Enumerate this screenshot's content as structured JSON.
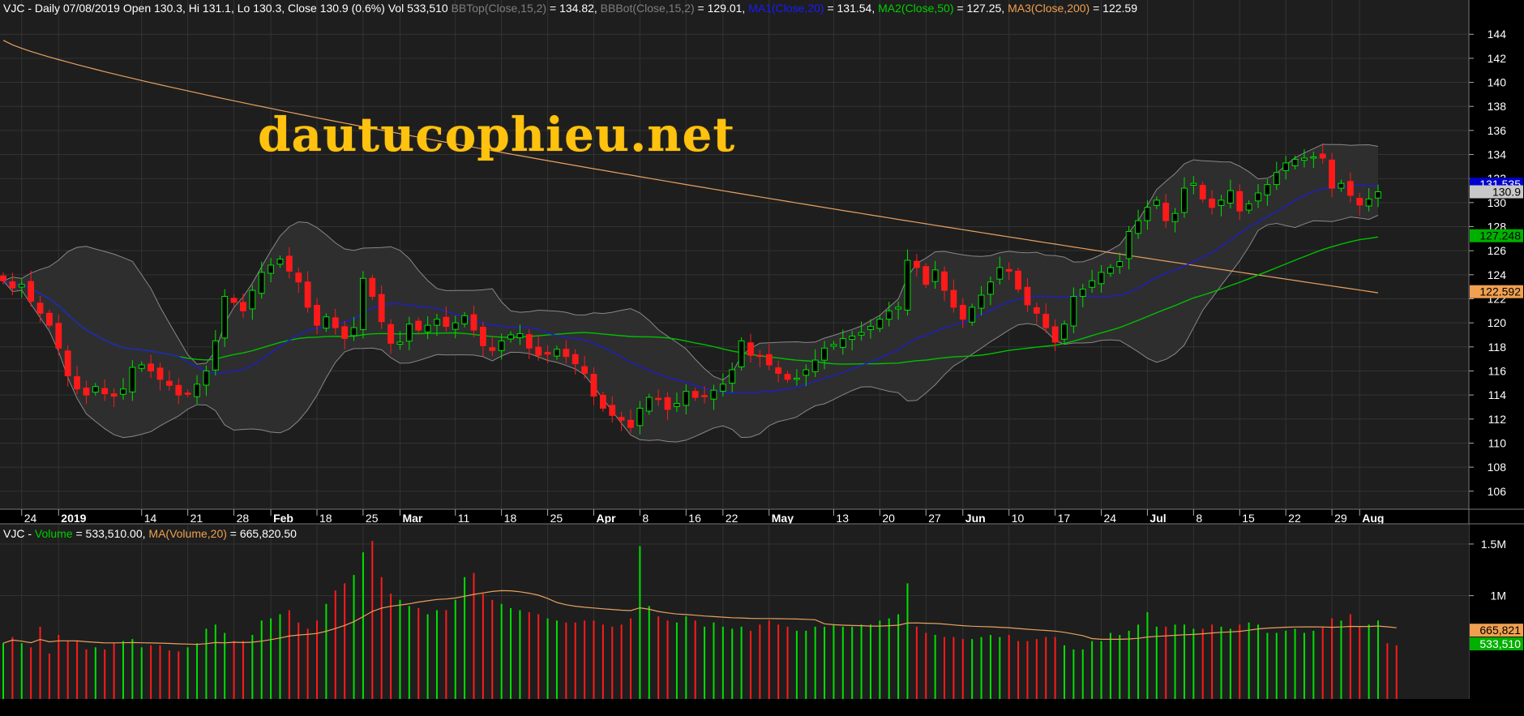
{
  "colors": {
    "background": "#000000",
    "pane": "#1e1e1e",
    "grid": "#333333",
    "up": "#00e000",
    "down": "#ff1a1a",
    "bollinger": "#888888",
    "ma1": "#1e1ecc",
    "ma2": "#00c000",
    "ma3": "#e8a060",
    "volume_ma": "#e8a060",
    "watermark": "#ffc20e"
  },
  "price_header": {
    "segments": [
      {
        "text": "VJC - Daily 07/08/2019 Open 130.3, Hi 131.1, Lo 130.3, Close 130.9 (0.6%) Vol 533,510 ",
        "color": "white"
      },
      {
        "text": "BBTop(Close,15,2)",
        "color": "gray"
      },
      {
        "text": " = 134.82, ",
        "color": "white"
      },
      {
        "text": "BBBot(Close,15,2)",
        "color": "gray"
      },
      {
        "text": " = 129.01, ",
        "color": "white"
      },
      {
        "text": "MA1(Close,20)",
        "color": "blue"
      },
      {
        "text": " = 131.54, ",
        "color": "white"
      },
      {
        "text": "MA2(Close,50)",
        "color": "green"
      },
      {
        "text": " = 127.25, ",
        "color": "white"
      },
      {
        "text": "MA3(Close,200)",
        "color": "orange"
      },
      {
        "text": " = 122.59",
        "color": "white"
      }
    ]
  },
  "volume_header": {
    "segments": [
      {
        "text": "VJC - ",
        "color": "white"
      },
      {
        "text": "Volume",
        "color": "green"
      },
      {
        "text": " = 533,510.00, ",
        "color": "white"
      },
      {
        "text": "MA(Volume,20)",
        "color": "orange"
      },
      {
        "text": " = 665,820.50",
        "color": "white"
      }
    ]
  },
  "watermark": "dautucophieu.net",
  "chart_data": [
    {
      "type": "candlestick",
      "name": "price",
      "ylim": [
        104.5,
        145.5
      ],
      "y_ticks": [
        106,
        108,
        110,
        112,
        114,
        116,
        118,
        120,
        122,
        124,
        126,
        128,
        130,
        132,
        134,
        136,
        138,
        140,
        142,
        144
      ],
      "x_tick_labels": [
        {
          "label": "24",
          "index": 2,
          "bold": false
        },
        {
          "label": "2019",
          "index": 6,
          "bold": true
        },
        {
          "label": "14",
          "index": 15,
          "bold": false
        },
        {
          "label": "21",
          "index": 20,
          "bold": false
        },
        {
          "label": "28",
          "index": 25,
          "bold": false
        },
        {
          "label": "Feb",
          "index": 29,
          "bold": true
        },
        {
          "label": "18",
          "index": 34,
          "bold": false
        },
        {
          "label": "25",
          "index": 39,
          "bold": false
        },
        {
          "label": "Mar",
          "index": 43,
          "bold": true
        },
        {
          "label": "11",
          "index": 49,
          "bold": false
        },
        {
          "label": "18",
          "index": 54,
          "bold": false
        },
        {
          "label": "25",
          "index": 59,
          "bold": false
        },
        {
          "label": "Apr",
          "index": 64,
          "bold": true
        },
        {
          "label": "8",
          "index": 69,
          "bold": false
        },
        {
          "label": "16",
          "index": 74,
          "bold": false
        },
        {
          "label": "22",
          "index": 78,
          "bold": false
        },
        {
          "label": "May",
          "index": 83,
          "bold": true
        },
        {
          "label": "13",
          "index": 90,
          "bold": false
        },
        {
          "label": "20",
          "index": 95,
          "bold": false
        },
        {
          "label": "27",
          "index": 100,
          "bold": false
        },
        {
          "label": "Jun",
          "index": 104,
          "bold": true
        },
        {
          "label": "10",
          "index": 109,
          "bold": false
        },
        {
          "label": "17",
          "index": 114,
          "bold": false
        },
        {
          "label": "24",
          "index": 119,
          "bold": false
        },
        {
          "label": "Jul",
          "index": 124,
          "bold": true
        },
        {
          "label": "8",
          "index": 129,
          "bold": false
        },
        {
          "label": "15",
          "index": 134,
          "bold": false
        },
        {
          "label": "22",
          "index": 139,
          "bold": false
        },
        {
          "label": "29",
          "index": 144,
          "bold": false
        },
        {
          "label": "Aug",
          "index": 147,
          "bold": true
        }
      ],
      "last_value_tags": [
        {
          "label": "131.535",
          "value": 131.535,
          "bg": "#0000cc",
          "fg": "#ffffff"
        },
        {
          "label": "130.9",
          "value": 130.9,
          "bg": "#c8c8c8",
          "fg": "#000000"
        },
        {
          "label": "127.248",
          "value": 127.248,
          "bg": "#00b000",
          "fg": "#000000"
        },
        {
          "label": "122.592",
          "value": 122.592,
          "bg": "#f0a050",
          "fg": "#000000"
        }
      ],
      "candles_close": [
        123.5,
        122.9,
        123.2,
        121.8,
        120.8,
        119.8,
        117.9,
        115.6,
        114.5,
        114.0,
        114.7,
        114.1,
        113.9,
        114.5,
        116.3,
        116.5,
        116.0,
        115.3,
        114.8,
        114.0,
        114.1,
        114.9,
        116.0,
        118.5,
        122.2,
        121.7,
        121.0,
        122.7,
        124.2,
        124.8,
        125.3,
        124.3,
        123.4,
        121.3,
        119.8,
        120.5,
        119.6,
        118.7,
        119.6,
        123.7,
        122.2,
        120.1,
        118.3,
        118.4,
        119.9,
        119.4,
        119.8,
        120.3,
        119.7,
        120.0,
        120.6,
        119.4,
        118.1,
        117.7,
        118.5,
        119.0,
        119.1,
        117.9,
        117.3,
        117.4,
        117.8,
        117.2,
        116.6,
        115.8,
        113.9,
        112.9,
        112.3,
        111.9,
        111.3,
        112.9,
        113.8,
        113.7,
        112.8,
        113.3,
        114.3,
        113.8,
        113.9,
        114.4,
        114.9,
        116.1,
        118.5,
        117.3,
        117.2,
        116.5,
        115.8,
        115.3,
        115.4,
        116.1,
        116.9,
        117.9,
        118.2,
        118.7,
        118.9,
        119.2,
        119.7,
        120.3,
        121.0,
        121.3,
        125.2,
        124.6,
        123.2,
        124.4,
        122.7,
        121.3,
        120.3,
        121.3,
        122.3,
        123.4,
        124.6,
        124.3,
        122.8,
        121.5,
        120.8,
        119.6,
        118.4,
        119.9,
        122.2,
        122.8,
        123.5,
        124.2,
        124.6,
        125.1,
        127.6,
        128.5,
        129.6,
        130.2,
        128.5,
        129.1,
        131.2,
        131.6,
        130.3,
        129.6,
        130.2,
        131.0,
        129.3,
        129.9,
        130.8,
        131.5,
        132.5,
        133.3,
        133.6,
        133.7,
        133.8,
        133.7,
        131.2,
        131.6,
        130.6,
        129.8,
        130.3,
        130.9
      ],
      "volume": [
        540,
        600,
        540,
        500,
        700,
        440,
        620,
        560,
        560,
        480,
        500,
        480,
        540,
        560,
        580,
        500,
        520,
        520,
        470,
        460,
        500,
        540,
        680,
        720,
        640,
        560,
        560,
        620,
        760,
        780,
        820,
        860,
        740,
        680,
        760,
        920,
        1050,
        1120,
        1200,
        1420,
        1530,
        1180,
        1020,
        960,
        900,
        880,
        820,
        860,
        860,
        960,
        1180,
        1220,
        1020,
        960,
        920,
        880,
        860,
        840,
        820,
        780,
        760,
        740,
        740,
        760,
        760,
        720,
        700,
        720,
        780,
        1480,
        900,
        800,
        760,
        740,
        800,
        760,
        700,
        740,
        700,
        680,
        700,
        660,
        720,
        760,
        720,
        700,
        660,
        660,
        700,
        700,
        720,
        700,
        700,
        720,
        720,
        760,
        780,
        820,
        1120,
        700,
        640,
        620,
        600,
        600,
        580,
        580,
        600,
        620,
        600,
        620,
        560,
        560,
        580,
        600,
        600,
        520,
        480,
        480,
        560,
        560,
        640,
        620,
        660,
        720,
        840,
        700,
        700,
        720,
        720,
        680,
        680,
        720,
        700,
        680,
        720,
        740,
        720,
        640,
        640,
        660,
        680,
        640,
        660,
        700,
        780,
        760,
        820,
        700,
        720,
        760,
        540,
        520
      ],
      "volume_ylim": [
        0,
        1680
      ],
      "volume_ticks": [
        {
          "label": "1.5M",
          "value": 1500
        },
        {
          "label": "1M",
          "value": 1000
        }
      ],
      "volume_tags": [
        {
          "label": "665,821",
          "value": 665.821,
          "bg": "#f0a050",
          "fg": "#000000"
        },
        {
          "label": "533,510",
          "value": 533.51,
          "bg": "#00b000",
          "fg": "#ffffff"
        }
      ]
    }
  ]
}
